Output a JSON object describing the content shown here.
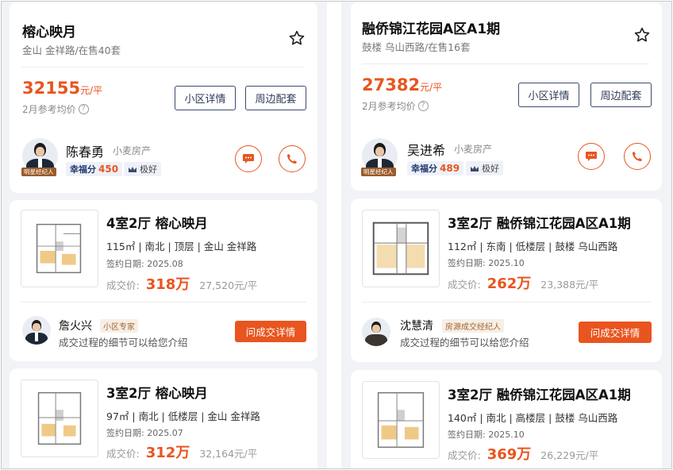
{
  "communities": [
    {
      "name": "榕心映月",
      "location": "金山 金祥路/在售40套",
      "price": "32155",
      "price_unit": "元/平",
      "price_note": "2月参考均价",
      "buttons": {
        "details": "小区详情",
        "surroundings": "周边配套"
      },
      "agent": {
        "name": "陈春勇",
        "company": "小麦房产",
        "tag": "明星经纪人",
        "score_label": "幸福分",
        "score": "450",
        "rating": "极好"
      },
      "listings": [
        {
          "title": "4室2厅 榕心映月",
          "specs": "115㎡ | 南北 | 顶层 | 金山 金祥路",
          "sign_date": "签约日期: 2025.08",
          "deal_label": "成交价:",
          "deal_price": "318万",
          "unit_price": "27,520元/平",
          "agent": {
            "name": "詹火兴",
            "badge": "小区专家",
            "desc": "成交过程的细节可以给您介绍",
            "button": "问成交详情"
          }
        },
        {
          "title": "3室2厅 榕心映月",
          "specs": "97㎡ | 南北 | 低楼层 | 金山 金祥路",
          "sign_date": "签约日期: 2025.07",
          "deal_label": "成交价:",
          "deal_price": "312万",
          "unit_price": "32,164元/平"
        }
      ]
    },
    {
      "name": "融侨锦江花园A区A1期",
      "location": "鼓楼 乌山西路/在售16套",
      "price": "27382",
      "price_unit": "元/平",
      "price_note": "2月参考均价",
      "buttons": {
        "details": "小区详情",
        "surroundings": "周边配套"
      },
      "agent": {
        "name": "吴进希",
        "company": "小麦房产",
        "tag": "明星经纪人",
        "score_label": "幸福分",
        "score": "489",
        "rating": "极好"
      },
      "listings": [
        {
          "title": "3室2厅 融侨锦江花园A区A1期",
          "specs": "112㎡ | 东南 | 低楼层 | 鼓楼 乌山西路",
          "sign_date": "签约日期: 2025.10",
          "deal_label": "成交价:",
          "deal_price": "262万",
          "unit_price": "23,388元/平",
          "agent": {
            "name": "沈慧清",
            "badge": "房源成交经纪人",
            "desc": "成交过程的细节可以给您介绍",
            "button": "问成交详情"
          }
        },
        {
          "title": "3室2厅 融侨锦江花园A区A1期",
          "specs": "140㎡ | 南北 | 高楼层 | 鼓楼 乌山西路",
          "sign_date": "签约日期: 2025.10",
          "deal_label": "成交价:",
          "deal_price": "369万",
          "unit_price": "26,229元/平"
        }
      ]
    }
  ],
  "colors": {
    "accent": "#e8551f",
    "navy": "#2f3b58",
    "background": "#f2f3f6"
  },
  "icons": [
    "star-icon",
    "question-icon",
    "message-icon",
    "phone-icon",
    "crown-icon"
  ]
}
